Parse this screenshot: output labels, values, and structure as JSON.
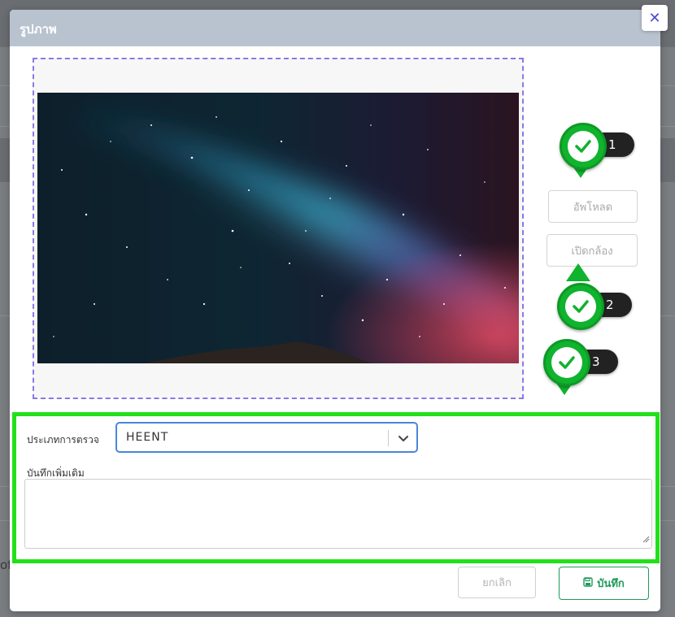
{
  "modal": {
    "title": "รูปภาพ",
    "close_icon": "close-icon",
    "close_label": "✕"
  },
  "side_buttons": {
    "upload_label": "อัพโหลด",
    "camera_label": "เปิดกล้อง"
  },
  "markers": [
    {
      "number": "1"
    },
    {
      "number": "2"
    },
    {
      "number": "3"
    }
  ],
  "form": {
    "exam_type_label": "ประเภทการตรวจ",
    "exam_type_value": "HEENT",
    "notes_label": "บันทึกเพิ่มเติม",
    "notes_value": ""
  },
  "footer": {
    "cancel_label": "ยกเลิก",
    "save_label": "บันทึก",
    "save_icon": "save-icon"
  },
  "background": {
    "partial_text": "of"
  },
  "colors": {
    "header": "#b9c3cf",
    "highlight": "#22e01a",
    "marker_green": "#10b32e",
    "frame_dash": "#8b78e6",
    "save_green": "#1e9a5a"
  }
}
